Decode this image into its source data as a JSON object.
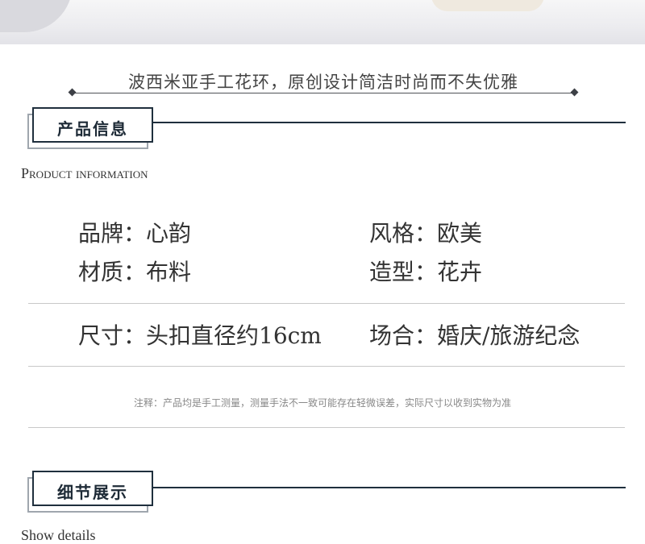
{
  "tagline": "波西米亚手工花环，原创设计简洁时尚而不失优雅",
  "product_section": {
    "title": "产品信息",
    "subtitle": "Product information"
  },
  "specs": {
    "brand": "品牌：心韵",
    "style": "风格：欧美",
    "material": "材质：布料",
    "shape": "造型：花卉",
    "size": "尺寸：头扣直径约16cm",
    "occasion": "场合：婚庆/旅游纪念"
  },
  "note": "注释：产品均是手工测量，测量手法不一致可能存在轻微误差，实际尺寸以收到实物为准",
  "details_section": {
    "title": "细节展示",
    "subtitle": "Show details"
  }
}
